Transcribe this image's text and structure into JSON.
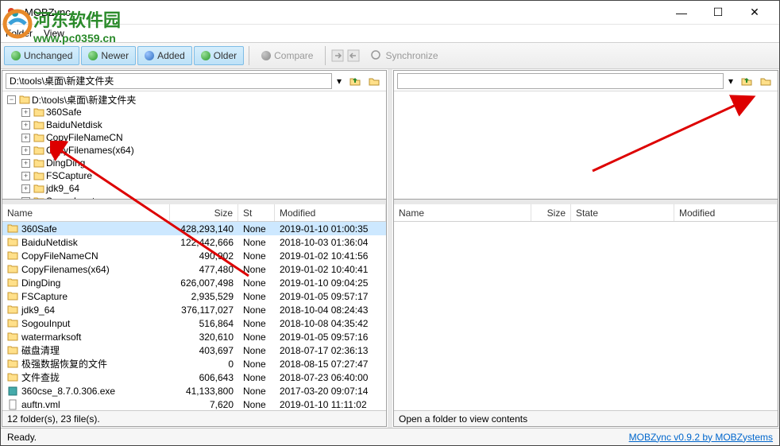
{
  "window": {
    "title": "MOBZync"
  },
  "watermark": {
    "text": "河东软件园",
    "url": "www.pc0359.cn"
  },
  "menu": {
    "folder": "Folder",
    "view": "View"
  },
  "toolbar": {
    "unchanged": "Unchanged",
    "newer": "Newer",
    "added": "Added",
    "older": "Older",
    "compare": "Compare",
    "synchronize": "Synchronize"
  },
  "left": {
    "path": "D:\\tools\\桌面\\新建文件夹",
    "tree_root": "D:\\tools\\桌面\\新建文件夹",
    "tree_children": [
      "360Safe",
      "BaiduNetdisk",
      "CopyFileNameCN",
      "CopyFilenames(x64)",
      "DingDing",
      "FSCapture",
      "jdk9_64",
      "SogouInput"
    ],
    "headers": {
      "name": "Name",
      "size": "Size",
      "st": "St",
      "modified": "Modified"
    },
    "rows": [
      {
        "name": "360Safe",
        "size": "428,293,140",
        "st": "None",
        "mod": "2019-01-10 01:00:35",
        "kind": "folder",
        "sel": true
      },
      {
        "name": "BaiduNetdisk",
        "size": "122,442,666",
        "st": "None",
        "mod": "2018-10-03 01:36:04",
        "kind": "folder"
      },
      {
        "name": "CopyFileNameCN",
        "size": "490,902",
        "st": "None",
        "mod": "2019-01-02 10:41:56",
        "kind": "folder"
      },
      {
        "name": "CopyFilenames(x64)",
        "size": "477,480",
        "st": "None",
        "mod": "2019-01-02 10:40:41",
        "kind": "folder"
      },
      {
        "name": "DingDing",
        "size": "626,007,498",
        "st": "None",
        "mod": "2019-01-10 09:04:25",
        "kind": "folder"
      },
      {
        "name": "FSCapture",
        "size": "2,935,529",
        "st": "None",
        "mod": "2019-01-05 09:57:17",
        "kind": "folder"
      },
      {
        "name": "jdk9_64",
        "size": "376,117,027",
        "st": "None",
        "mod": "2018-10-04 08:24:43",
        "kind": "folder"
      },
      {
        "name": "SogouInput",
        "size": "516,864",
        "st": "None",
        "mod": "2018-10-08 04:35:42",
        "kind": "folder"
      },
      {
        "name": "watermarksoft",
        "size": "320,610",
        "st": "None",
        "mod": "2019-01-05 09:57:16",
        "kind": "folder"
      },
      {
        "name": "磁盘清理",
        "size": "403,697",
        "st": "None",
        "mod": "2018-07-17 02:36:13",
        "kind": "folder"
      },
      {
        "name": "极强数据恢复的文件",
        "size": "0",
        "st": "None",
        "mod": "2018-08-15 07:27:47",
        "kind": "folder"
      },
      {
        "name": "文件查拢",
        "size": "606,643",
        "st": "None",
        "mod": "2018-07-23 06:40:00",
        "kind": "folder"
      },
      {
        "name": "360cse_8.7.0.306.exe",
        "size": "41,133,800",
        "st": "None",
        "mod": "2017-03-20 09:07:14",
        "kind": "exe"
      },
      {
        "name": "auftn.vml",
        "size": "7,620",
        "st": "None",
        "mod": "2019-01-10 11:11:02",
        "kind": "file"
      }
    ],
    "status": "12 folder(s), 23 file(s)."
  },
  "right": {
    "path": "",
    "headers": {
      "name": "Name",
      "size": "Size",
      "state": "State",
      "modified": "Modified"
    },
    "status": "Open a folder to view contents"
  },
  "status": {
    "ready": "Ready.",
    "version": "MOBZync v0.9.2 by MOBZystems"
  }
}
